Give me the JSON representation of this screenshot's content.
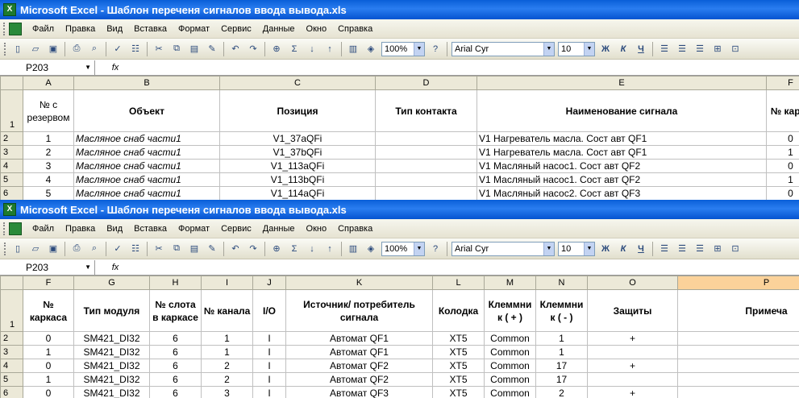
{
  "window": {
    "title": "Microsoft Excel - Шаблон переченя сигналов ввода вывода.xls",
    "menu": [
      "Файл",
      "Правка",
      "Вид",
      "Вставка",
      "Формат",
      "Сервис",
      "Данные",
      "Окно",
      "Справка"
    ]
  },
  "toolbar": {
    "zoom": "100%",
    "font": "Arial Cyr",
    "font_size": "10",
    "bold": "Ж",
    "italic": "К",
    "underline": "Ч",
    "sigma": "Σ"
  },
  "formula_bar": {
    "name_box": "P203",
    "fx": "fx"
  },
  "sheet1": {
    "columns": [
      "A",
      "B",
      "C",
      "D",
      "E",
      "F"
    ],
    "header_row_num": "1",
    "headers": [
      "№ с резервом",
      "Объект",
      "Позиция",
      "Тип контакта",
      "Наименование сигнала",
      "№ карка"
    ],
    "rows": [
      {
        "num": "2",
        "cells": [
          "1",
          "Масляное снаб части1",
          "V1_37aQFi",
          "",
          "V1 Нагреватель масла. Сост авт QF1",
          "0"
        ]
      },
      {
        "num": "3",
        "cells": [
          "2",
          "Масляное снаб части1",
          "V1_37bQFi",
          "",
          "V1 Нагреватель масла. Сост авт QF1",
          "1"
        ]
      },
      {
        "num": "4",
        "cells": [
          "3",
          "Масляное снаб части1",
          "V1_113aQFi",
          "",
          "V1 Масляный насос1. Сост авт QF2",
          "0"
        ]
      },
      {
        "num": "5",
        "cells": [
          "4",
          "Масляное снаб части1",
          "V1_113bQFi",
          "",
          "V1 Масляный насос1. Сост авт QF2",
          "1"
        ]
      },
      {
        "num": "6",
        "cells": [
          "5",
          "Масляное снаб части1",
          "V1_114aQFi",
          "",
          "V1 Масляный насос2. Сост авт QF3",
          "0"
        ]
      }
    ]
  },
  "sheet2": {
    "columns": [
      "F",
      "G",
      "H",
      "I",
      "J",
      "K",
      "L",
      "M",
      "N",
      "O",
      "P"
    ],
    "header_row_num": "1",
    "headers": [
      "№ каркаса",
      "Тип модуля",
      "№ слота в каркасе",
      "№ канала",
      "I/O",
      "Источник/ потребитель сигнала",
      "Колодка",
      "Клеммни к ( + )",
      "Клеммни к ( - )",
      "Защиты",
      "Примеча"
    ],
    "rows": [
      {
        "num": "2",
        "cells": [
          "0",
          "SM421_DI32",
          "6",
          "1",
          "I",
          "Автомат QF1",
          "XT5",
          "Common",
          "1",
          "+",
          ""
        ]
      },
      {
        "num": "3",
        "cells": [
          "1",
          "SM421_DI32",
          "6",
          "1",
          "I",
          "Автомат QF1",
          "XT5",
          "Common",
          "1",
          "",
          ""
        ]
      },
      {
        "num": "4",
        "cells": [
          "0",
          "SM421_DI32",
          "6",
          "2",
          "I",
          "Автомат QF2",
          "XT5",
          "Common",
          "17",
          "+",
          ""
        ]
      },
      {
        "num": "5",
        "cells": [
          "1",
          "SM421_DI32",
          "6",
          "2",
          "I",
          "Автомат QF2",
          "XT5",
          "Common",
          "17",
          "",
          ""
        ]
      },
      {
        "num": "6",
        "cells": [
          "0",
          "SM421_DI32",
          "6",
          "3",
          "I",
          "Автомат QF3",
          "XT5",
          "Common",
          "2",
          "+",
          ""
        ]
      }
    ]
  }
}
